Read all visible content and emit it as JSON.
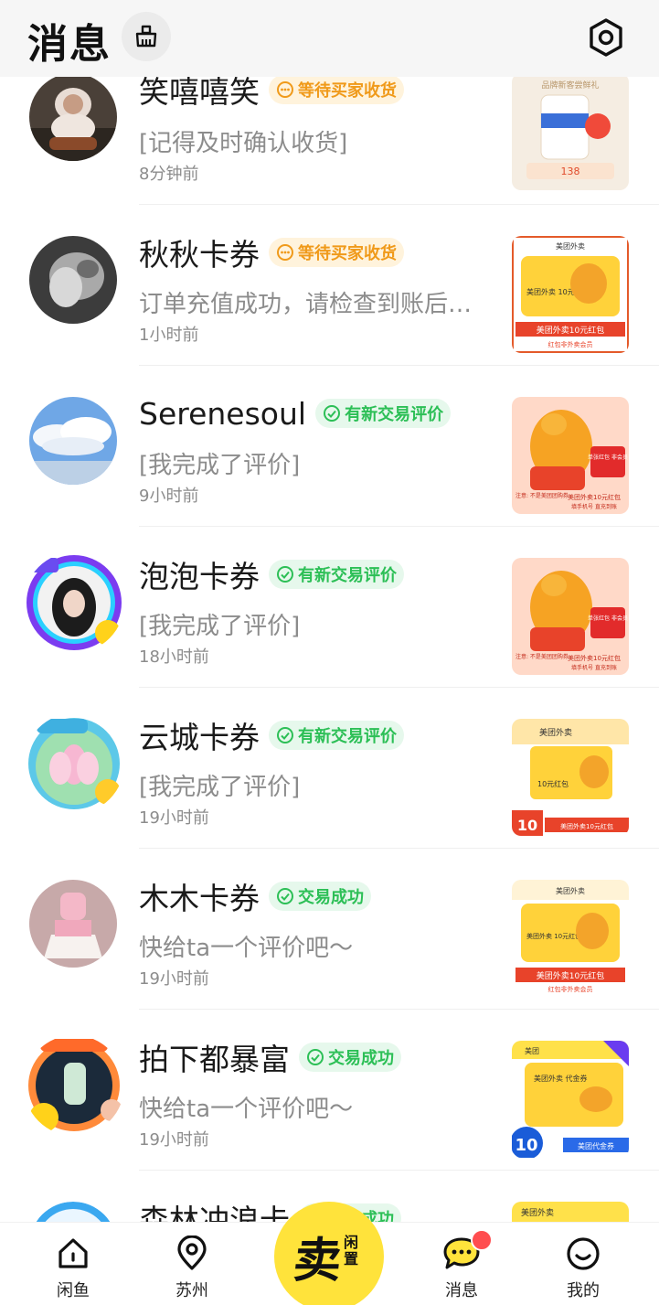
{
  "header": {
    "title": "消息",
    "clean_icon": "broom-icon",
    "settings_icon": "settings-hexagon-icon"
  },
  "conversations": [
    {
      "name": "笑嘻嘻笑",
      "badge": "等待买家收货",
      "badge_type": "orange",
      "preview": "[记得及时确认收货]",
      "time": "8分钟前"
    },
    {
      "name": "秋秋卡券",
      "badge": "等待买家收货",
      "badge_type": "orange",
      "preview": "订单充值成功，请检查到账后…",
      "time": "1小时前"
    },
    {
      "name": "Serenesoul",
      "badge": "有新交易评价",
      "badge_type": "green",
      "preview": "[我完成了评价]",
      "time": "9小时前"
    },
    {
      "name": "泡泡卡券",
      "badge": "有新交易评价",
      "badge_type": "green",
      "preview": "[我完成了评价]",
      "time": "18小时前"
    },
    {
      "name": "云城卡券",
      "badge": "有新交易评价",
      "badge_type": "green",
      "preview": "[我完成了评价]",
      "time": "19小时前"
    },
    {
      "name": "木木卡券",
      "badge": "交易成功",
      "badge_type": "green",
      "preview": "快给ta一个评价吧～",
      "time": "19小时前"
    },
    {
      "name": "拍下都暴富",
      "badge": "交易成功",
      "badge_type": "green",
      "preview": "快给ta一个评价吧～",
      "time": "19小时前"
    },
    {
      "name": "森林冲浪卡",
      "badge": "交易成功",
      "badge_type": "green",
      "preview": "",
      "time": ""
    }
  ],
  "thumbnails": {
    "t0": {
      "line1": "品牌新客尝鲜礼",
      "line2": "138"
    },
    "t1": {
      "brand": "美团外卖",
      "card": "美团外卖\n10元红包",
      "footer": "美团外卖10元红包",
      "sub": "红包非外卖会员"
    },
    "t2": {
      "warn": "单张红包\n非会员",
      "footer": "美团外卖10元红包",
      "sub": "填手机号 直充到账",
      "note": "注意: 不是美团团购券"
    },
    "t3": {
      "warn": "单张红包\n非会员",
      "footer": "美团外卖10元红包",
      "sub": "填手机号 直充到账",
      "note": "注意: 不是美团团购券"
    },
    "t4": {
      "brand": "美团外卖",
      "card": "10元红包",
      "footer": "美团外卖10元红包",
      "price": "10"
    },
    "t5": {
      "brand": "美团外卖",
      "card": "美团外卖 10元红包",
      "footer": "美团外卖10元红包",
      "sub": "红包非外卖会员"
    },
    "t6": {
      "brand": "美团",
      "card": "美团外卖 代金券",
      "footer": "美团代金券",
      "price": "10"
    },
    "t7": {
      "brand": "美团外卖"
    }
  },
  "bottom_nav": {
    "home_label": "闲鱼",
    "city_label": "苏州",
    "sell_main": "卖",
    "sell_sub": "闲置",
    "messages_label": "消息",
    "me_label": "我的"
  },
  "colors": {
    "accent_yellow": "#ffe33b",
    "badge_orange": "#f09a1a",
    "badge_green": "#2cbf56",
    "notification_red": "#ff4d4f"
  }
}
